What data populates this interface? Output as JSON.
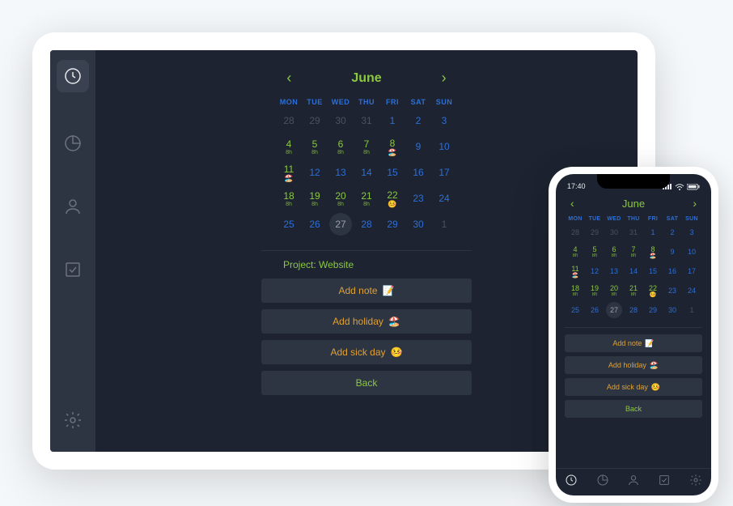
{
  "month": "June",
  "statusTime": "17:40",
  "weekdays": [
    "MON",
    "TUE",
    "WED",
    "THU",
    "FRI",
    "SAT",
    "SUN"
  ],
  "selectedDay": 27,
  "weeks": [
    [
      {
        "n": 28,
        "cls": "out"
      },
      {
        "n": 29,
        "cls": "out"
      },
      {
        "n": 30,
        "cls": "out"
      },
      {
        "n": 31,
        "cls": "out"
      },
      {
        "n": 1,
        "cls": "std"
      },
      {
        "n": 2,
        "cls": "std"
      },
      {
        "n": 3,
        "cls": "std"
      }
    ],
    [
      {
        "n": 4,
        "cls": "green",
        "h": "8h"
      },
      {
        "n": 5,
        "cls": "green",
        "h": "8h"
      },
      {
        "n": 6,
        "cls": "green",
        "h": "8h"
      },
      {
        "n": 7,
        "cls": "green",
        "h": "8h"
      },
      {
        "n": 8,
        "cls": "green",
        "e": "🏖️"
      },
      {
        "n": 9,
        "cls": "std"
      },
      {
        "n": 10,
        "cls": "std"
      }
    ],
    [
      {
        "n": 11,
        "cls": "green",
        "e": "🏖️"
      },
      {
        "n": 12,
        "cls": "std"
      },
      {
        "n": 13,
        "cls": "std"
      },
      {
        "n": 14,
        "cls": "std"
      },
      {
        "n": 15,
        "cls": "std"
      },
      {
        "n": 16,
        "cls": "std"
      },
      {
        "n": 17,
        "cls": "std"
      }
    ],
    [
      {
        "n": 18,
        "cls": "green",
        "h": "8h"
      },
      {
        "n": 19,
        "cls": "green",
        "h": "8h"
      },
      {
        "n": 20,
        "cls": "green",
        "h": "8h"
      },
      {
        "n": 21,
        "cls": "green",
        "h": "8h"
      },
      {
        "n": 22,
        "cls": "green",
        "e": "🤒"
      },
      {
        "n": 23,
        "cls": "std"
      },
      {
        "n": 24,
        "cls": "std"
      }
    ],
    [
      {
        "n": 25,
        "cls": "std"
      },
      {
        "n": 26,
        "cls": "std"
      },
      {
        "n": 27,
        "cls": "selected"
      },
      {
        "n": 28,
        "cls": "std"
      },
      {
        "n": 29,
        "cls": "std"
      },
      {
        "n": 30,
        "cls": "std"
      },
      {
        "n": 1,
        "cls": "out"
      }
    ]
  ],
  "projectLabel": "Project: Website",
  "buttons": {
    "addNote": "Add note",
    "addHoliday": "Add holiday",
    "addSickDay": "Add sick day",
    "back": "Back"
  },
  "emojis": {
    "note": "📝",
    "holiday": "🏖️",
    "sick": "🤒"
  }
}
